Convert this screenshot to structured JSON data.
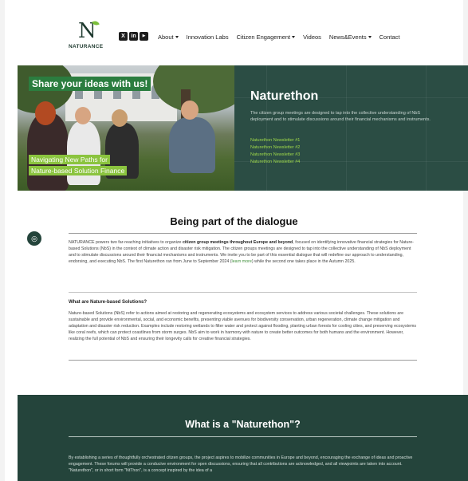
{
  "brand": {
    "logo_mark": "N",
    "logo_word": "NATURANCE"
  },
  "socials": [
    {
      "label": "X",
      "icon": "x-icon"
    },
    {
      "label": "in",
      "icon": "linkedin-icon"
    },
    {
      "label": "▶",
      "icon": "youtube-icon"
    }
  ],
  "nav": {
    "about": "About",
    "innovation_labs": "Innovation Labs",
    "citizen_engagement": "Citizen Engagement",
    "videos": "Videos",
    "news_events": "News&Events",
    "contact": "Contact"
  },
  "hero": {
    "banner_top": "Share your ideas with us!",
    "banner_bottom_1": "Navigating New Paths for",
    "banner_bottom_2": "Nature-based Solution Finance",
    "title": "Naturethon",
    "description": "The citizen group meetings are designed to tap into the collective understanding of NbS deployment and to stimulate discussions around their financial mechanisms and instruments.",
    "newsletters": [
      "Naturethon Newsletter #1",
      "Naturethon Newsletter #2",
      "Naturethon Newsletter #3",
      "Naturethon Newsletter #4"
    ]
  },
  "section1": {
    "title": "Being part of the dialogue",
    "para1_a": "NATURANCE powers two far-reaching initiatives to organize ",
    "para1_bold": "citizen group meetings throughout Europe and beyond",
    "para1_b": ", focused on identifying innovative financial strategies for Nature-based Solutions (NbS) in the context of climate action and disaster risk mitigation. The citizen groups meetings are designed to tap into the collective understanding of NbS deployment and to stimulate discussions around their financial mechanisms and instruments. We invite you to be part of this essential dialogue that will redefine our approach to understanding, endorsing, and executing NbS. The first Naturethon ran from June to September 2024 (",
    "para1_link": "learn more",
    "para1_c": ") while the second one takes place in the Autumn 2025.",
    "question": "What are Nature-based Solutions?",
    "para2": "Nature-based Solutions (NbS) refer to actions aimed at restoring and regenerating ecosystems and ecosystem services to address various societal challenges. These solutions are sustainable and provide environmental, social, and economic benefits, presenting viable avenues for biodiversity conservation, urban regeneration, climate change mitigation and adaptation and disaster risk reduction. Examples include restoring wetlands to filter water and protect against flooding, planting urban forests for cooling cities, and preserving ecosystems like coral reefs, which can protect coastlines from storm surges. NbS aim to work in harmony with nature to create better outcomes for both humans and the environment. However, realizing the full potential of NbS and ensuring their longevity calls for creative financial strategies."
  },
  "section2": {
    "title": "What is a \"Naturethon\"?",
    "para": "By establishing a series of thoughtfully orchestrated citizen groups, the project aspires to mobilize communities in Europe and beyond, encouraging the exchange of ideas and proactive engagement. These forums will provide a conducive environment for open discussions, ensuring that all contributions are acknowledged, and all viewpoints are taken into account. \"Naturethon\", or in short form \"NtThon\", is a concept inspired by the idea of a"
  },
  "colors": {
    "accent_green": "#8bc43f",
    "dark_teal": "#24443b",
    "banner_green": "#2b7d3f"
  }
}
